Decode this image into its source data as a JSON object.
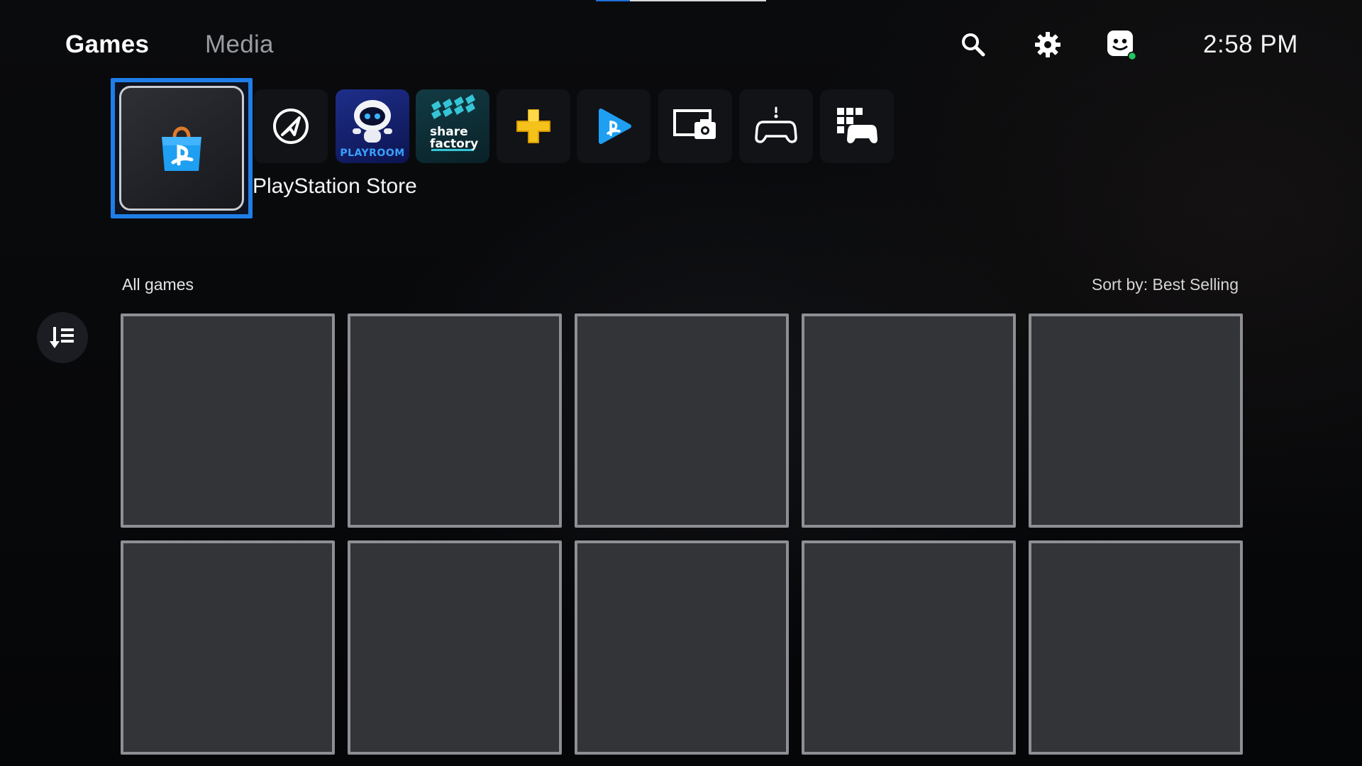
{
  "header": {
    "tabs": [
      {
        "label": "Games",
        "active": true
      },
      {
        "label": "Media",
        "active": false
      }
    ],
    "icons": [
      "search-icon",
      "gear-icon",
      "avatar-icon"
    ],
    "clock": "2:58 PM",
    "status_color": "#22c55e"
  },
  "launcher": {
    "selected_label": "PlayStation Store",
    "items": [
      {
        "name": "playstation-store",
        "icon": "shopping-bag-icon"
      },
      {
        "name": "explore",
        "icon": "compass-rocket-icon"
      },
      {
        "name": "astro-playroom",
        "icon": "astro-bot-icon",
        "text": "PLAYROOM"
      },
      {
        "name": "share-factory",
        "icon": "share-factory-icon",
        "text": [
          "share",
          "factory"
        ]
      },
      {
        "name": "playstation-plus",
        "icon": "plus-icon"
      },
      {
        "name": "playstation-video",
        "icon": "play-icon"
      },
      {
        "name": "media-gallery",
        "icon": "screen-camera-icon"
      },
      {
        "name": "remote-play",
        "icon": "controller-icon"
      },
      {
        "name": "game-library",
        "icon": "grid-controller-icon"
      }
    ],
    "accent_color": "#1f7ee8"
  },
  "library": {
    "section_title": "All games",
    "sort_label": "Sort by: Best Selling",
    "grid_tiles": 10
  }
}
